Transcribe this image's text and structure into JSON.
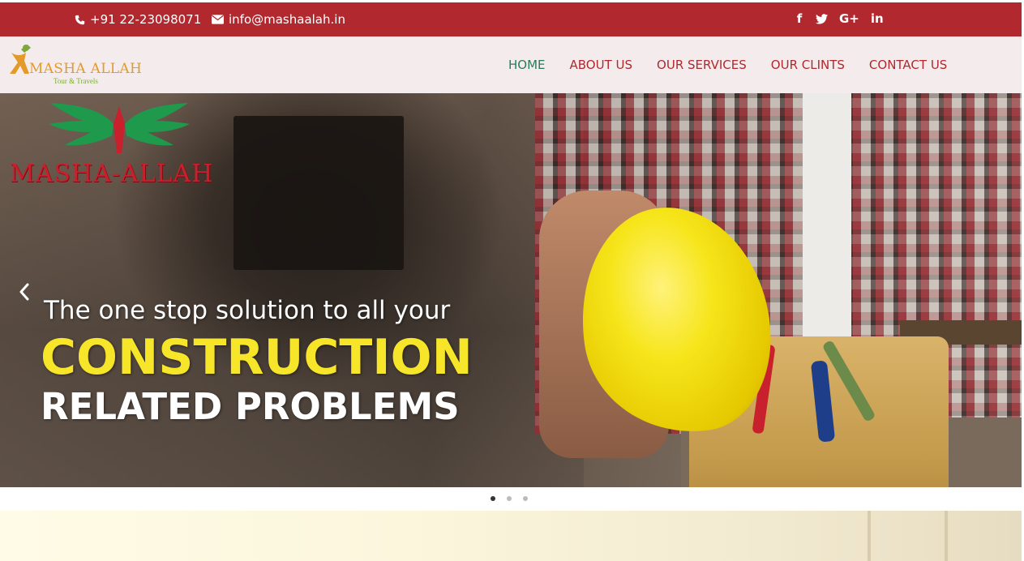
{
  "topbar": {
    "phone": "+91 22-23098071",
    "email": "info@mashaalah.in",
    "socials": [
      {
        "icon": "facebook-icon",
        "glyph": "f"
      },
      {
        "icon": "twitter-icon",
        "glyph": "🐦"
      },
      {
        "icon": "google-plus-icon",
        "glyph": "G+"
      },
      {
        "icon": "linkedin-icon",
        "glyph": "in"
      }
    ]
  },
  "logo": {
    "title": "MASHA ALLAH",
    "subtitle": "Tour & Travels"
  },
  "nav": {
    "items": [
      "HOME",
      "ABOUT US",
      "OUR SERVICES",
      "OUR CLINTS",
      "CONTACT US"
    ]
  },
  "hero": {
    "brand": "MASHA-ALLAH",
    "line1": "The one stop solution to all your",
    "line2": "CONSTRUCTION",
    "line3": "RELATED PROBLEMS"
  },
  "carousel": {
    "slide_count": 3,
    "active_index": 0
  },
  "colors": {
    "primary_red": "#b1282e",
    "nav_bg": "#f4ecec",
    "active_green": "#2c7a5a",
    "highlight_yellow": "#f7e52a"
  }
}
